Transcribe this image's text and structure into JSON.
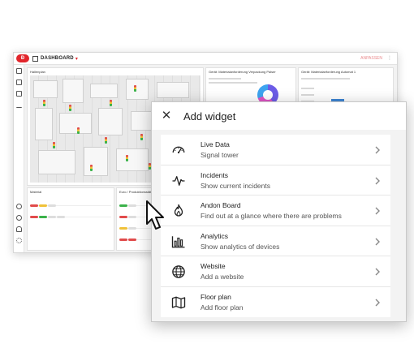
{
  "dashboard": {
    "logo": "Ð",
    "title": "DASHBOARD",
    "action_label": "ANPASSEN",
    "floor_panel_title": "Hallenplan",
    "chart_panel_1_title": "Gerät: Materialanforderung Verpackung Palser",
    "chart_panel_2_title": "Gerät: Materialanforderung Automat 1",
    "list_panel_1_title": "Material",
    "list_panel_2_title": "Euro / Produktionsstätte"
  },
  "modal": {
    "title": "Add widget",
    "close_icon": "close-icon",
    "items": [
      {
        "icon": "speedometer-icon",
        "title": "Live Data",
        "subtitle": "Signal tower"
      },
      {
        "icon": "pulse-icon",
        "title": "Incidents",
        "subtitle": "Show current incidents"
      },
      {
        "icon": "flame-icon",
        "title": "Andon Board",
        "subtitle": "Find out at a glance where there are problems"
      },
      {
        "icon": "bar-chart-icon",
        "title": "Analytics",
        "subtitle": "Show analytics of devices"
      },
      {
        "icon": "globe-icon",
        "title": "Website",
        "subtitle": "Add a website"
      },
      {
        "icon": "map-icon",
        "title": "Floor plan",
        "subtitle": "Add floor plan"
      }
    ]
  },
  "colors": {
    "brand": "#e2252b",
    "chart_bar": "#3e86d6"
  }
}
